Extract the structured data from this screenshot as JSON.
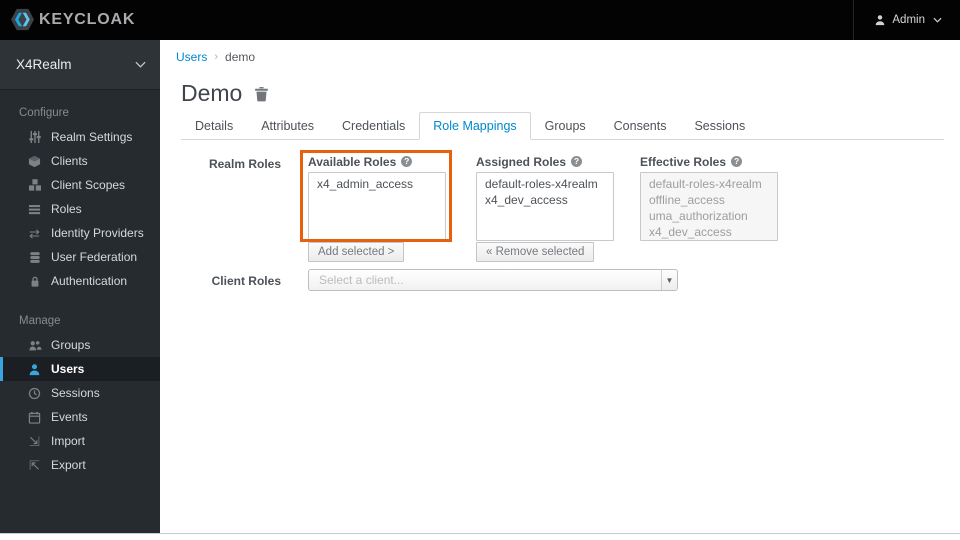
{
  "navbar": {
    "brand": "KEYCLOAK",
    "user_label": "Admin"
  },
  "sidebar": {
    "realm": "X4Realm",
    "sections": [
      {
        "label": "Configure",
        "items": [
          {
            "label": "Realm Settings",
            "icon": "sliders-icon"
          },
          {
            "label": "Clients",
            "icon": "cube-icon"
          },
          {
            "label": "Client Scopes",
            "icon": "cubes-icon"
          },
          {
            "label": "Roles",
            "icon": "list-icon"
          },
          {
            "label": "Identity Providers",
            "icon": "exchange-icon"
          },
          {
            "label": "User Federation",
            "icon": "database-icon"
          },
          {
            "label": "Authentication",
            "icon": "lock-icon"
          }
        ]
      },
      {
        "label": "Manage",
        "items": [
          {
            "label": "Groups",
            "icon": "groups-icon"
          },
          {
            "label": "Users",
            "icon": "user-icon",
            "active": true
          },
          {
            "label": "Sessions",
            "icon": "clock-icon"
          },
          {
            "label": "Events",
            "icon": "calendar-icon"
          },
          {
            "label": "Import",
            "icon": "import-icon"
          },
          {
            "label": "Export",
            "icon": "export-icon"
          }
        ]
      }
    ]
  },
  "breadcrumb": {
    "root": "Users",
    "current": "demo"
  },
  "page": {
    "title": "Demo"
  },
  "tabs": [
    "Details",
    "Attributes",
    "Credentials",
    "Role Mappings",
    "Groups",
    "Consents",
    "Sessions"
  ],
  "active_tab": "Role Mappings",
  "form": {
    "realm_roles_label": "Realm Roles",
    "client_roles_label": "Client Roles",
    "available": {
      "label": "Available Roles",
      "items": [
        "x4_admin_access"
      ],
      "button": "Add selected >"
    },
    "assigned": {
      "label": "Assigned Roles",
      "items": [
        "default-roles-x4realm",
        "x4_dev_access"
      ],
      "button": "« Remove selected"
    },
    "effective": {
      "label": "Effective Roles",
      "items": [
        "default-roles-x4realm",
        "offline_access",
        "uma_authorization",
        "x4_dev_access"
      ]
    },
    "client_select_placeholder": "Select a client..."
  },
  "colors": {
    "link_blue": "#0088ce",
    "sidebar_active_blue": "#39a5dc",
    "highlight_orange": "#e7600e",
    "navbar_black": "#030303",
    "sidebar_dark": "#262b2f"
  }
}
